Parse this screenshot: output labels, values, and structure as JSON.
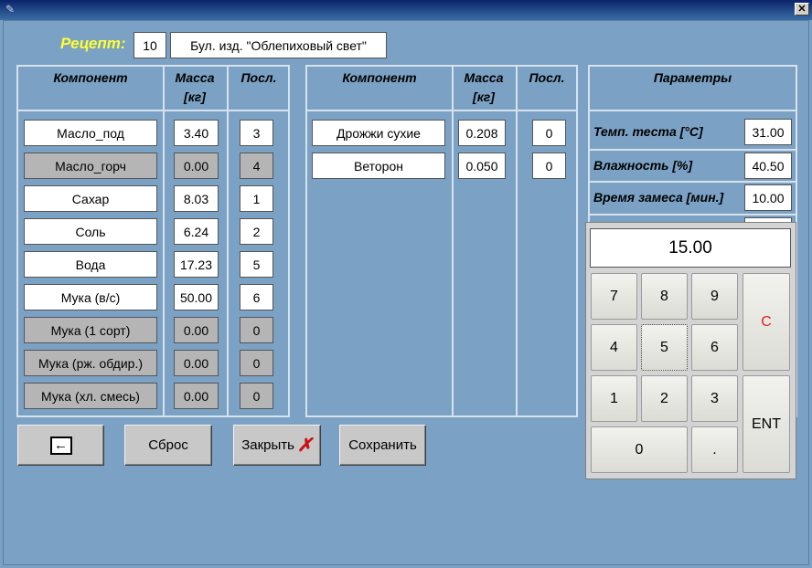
{
  "window": {
    "close_glyph": "✕"
  },
  "recipe": {
    "label": "Рецепт:",
    "number": "10",
    "name": "Бул. изд. \"Облепиховый свет\""
  },
  "left_table": {
    "headers": {
      "component": "Компонент",
      "mass": "Масса [кг]",
      "order": "Посл."
    },
    "rows": [
      {
        "name": "Масло_под",
        "mass": "3.40",
        "order": "3",
        "disabled": false
      },
      {
        "name": "Масло_горч",
        "mass": "0.00",
        "order": "4",
        "disabled": true
      },
      {
        "name": "Сахар",
        "mass": "8.03",
        "order": "1",
        "disabled": false
      },
      {
        "name": "Соль",
        "mass": "6.24",
        "order": "2",
        "disabled": false
      },
      {
        "name": "Вода",
        "mass": "17.23",
        "order": "5",
        "disabled": false
      },
      {
        "name": "Мука (в/с)",
        "mass": "50.00",
        "order": "6",
        "disabled": false
      },
      {
        "name": "Мука (1 сорт)",
        "mass": "0.00",
        "order": "0",
        "disabled": true
      },
      {
        "name": "Мука (рж. обдир.)",
        "mass": "0.00",
        "order": "0",
        "disabled": true
      },
      {
        "name": "Мука (хл. смесь)",
        "mass": "0.00",
        "order": "0",
        "disabled": true
      }
    ]
  },
  "middle_table": {
    "headers": {
      "component": "Компонент",
      "mass": "Масса [кг]",
      "order": "Посл."
    },
    "rows": [
      {
        "name": "Дрожжи сухие",
        "mass": "0.208",
        "order": "0"
      },
      {
        "name": "Веторон",
        "mass": "0.050",
        "order": "0"
      }
    ]
  },
  "parameters": {
    "header": "Параметры",
    "rows": [
      {
        "label": "Темп. теста [°C]",
        "value": "31.00"
      },
      {
        "label": "Влажность [%]",
        "value": "40.50"
      },
      {
        "label": "Время замеса [мин.]",
        "value": "10.00"
      }
    ]
  },
  "buttons": {
    "reset": "Сброс",
    "close": "Закрыть",
    "save": "Сохранить"
  },
  "keypad": {
    "display": "15.00",
    "keys": [
      "7",
      "8",
      "9",
      "4",
      "5",
      "6",
      "1",
      "2",
      "3",
      "0",
      "."
    ],
    "clear": "C",
    "enter": "ENT"
  },
  "colors": {
    "background": "#7ba1c4",
    "recipe_label": "#ffff33",
    "clear_key": "#e02020",
    "close_icon": "#cc1010"
  }
}
